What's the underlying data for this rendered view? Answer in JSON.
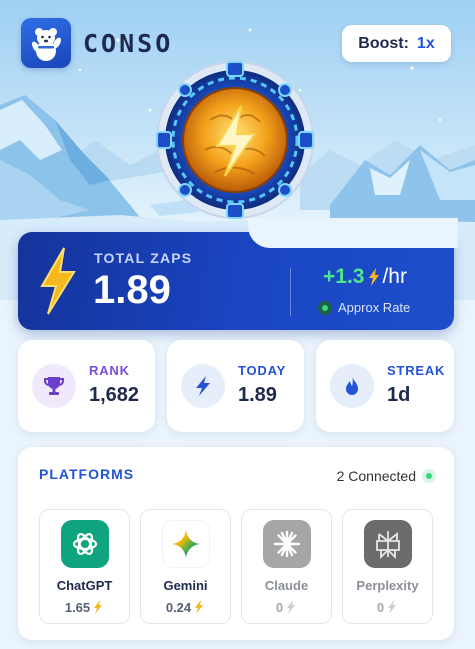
{
  "app": {
    "name": "CONSO"
  },
  "boost": {
    "label": "Boost:",
    "value": "1x"
  },
  "zaps": {
    "title": "TOTAL ZAPS",
    "value": "1.89",
    "rate": "+1.3",
    "rate_unit": "/hr",
    "rate_label": "Approx Rate"
  },
  "stats": [
    {
      "label": "RANK",
      "value": "1,682",
      "icon": "trophy-icon",
      "color": "#7b4fd6"
    },
    {
      "label": "TODAY",
      "value": "1.89",
      "icon": "lightning-icon",
      "color": "#2353d8"
    },
    {
      "label": "STREAK",
      "value": "1d",
      "icon": "flame-icon",
      "color": "#2353d8"
    }
  ],
  "platforms": {
    "title": "PLATFORMS",
    "connected": "2 Connected",
    "items": [
      {
        "name": "ChatGPT",
        "score": "1.65",
        "active": true,
        "icon": "chatgpt-logo"
      },
      {
        "name": "Gemini",
        "score": "0.24",
        "active": true,
        "icon": "gemini-logo"
      },
      {
        "name": "Claude",
        "score": "0",
        "active": false,
        "icon": "claude-logo"
      },
      {
        "name": "Perplexity",
        "score": "0",
        "active": false,
        "icon": "perplexity-logo"
      }
    ]
  },
  "colors": {
    "accent": "#2353d8",
    "card_blue": "#1a46c4",
    "green": "#38d67a",
    "bolt_yellow": "#f5b81f"
  }
}
